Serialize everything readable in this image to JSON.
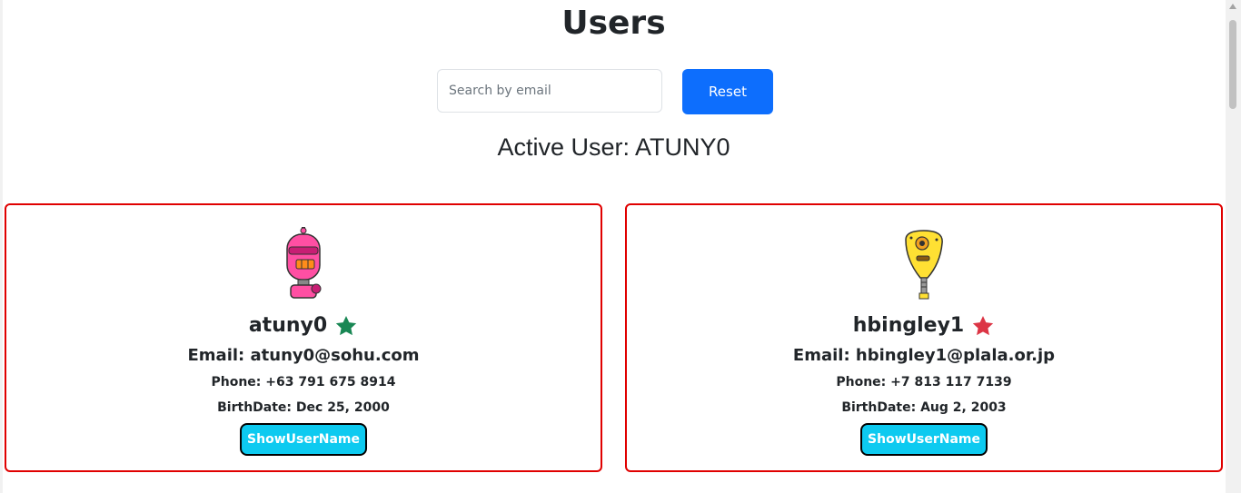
{
  "header": {
    "title": "Users"
  },
  "search": {
    "placeholder": "Search by email",
    "value": ""
  },
  "reset_label": "Reset",
  "active_user": "Active User: ATUNY0",
  "users": [
    {
      "username": "atuny0",
      "email": "Email: atuny0@sohu.com",
      "phone": "Phone: +63 791 675 8914",
      "birthdate": "BirthDate: Dec 25, 2000",
      "button_label": "ShowUserName",
      "star_color": "#198754",
      "avatar": "pink-robot-avatar"
    },
    {
      "username": "hbingley1",
      "email": "Email: hbingley1@plala.or.jp",
      "phone": "Phone: +7 813 117 7139",
      "birthdate": "BirthDate: Aug 2, 2003",
      "button_label": "ShowUserName",
      "star_color": "#dc3545",
      "avatar": "yellow-robot-avatar"
    }
  ],
  "colors": {
    "card_border": "#e00000",
    "reset_button": "#0d6efd",
    "show_button": "#0dcaf0"
  }
}
